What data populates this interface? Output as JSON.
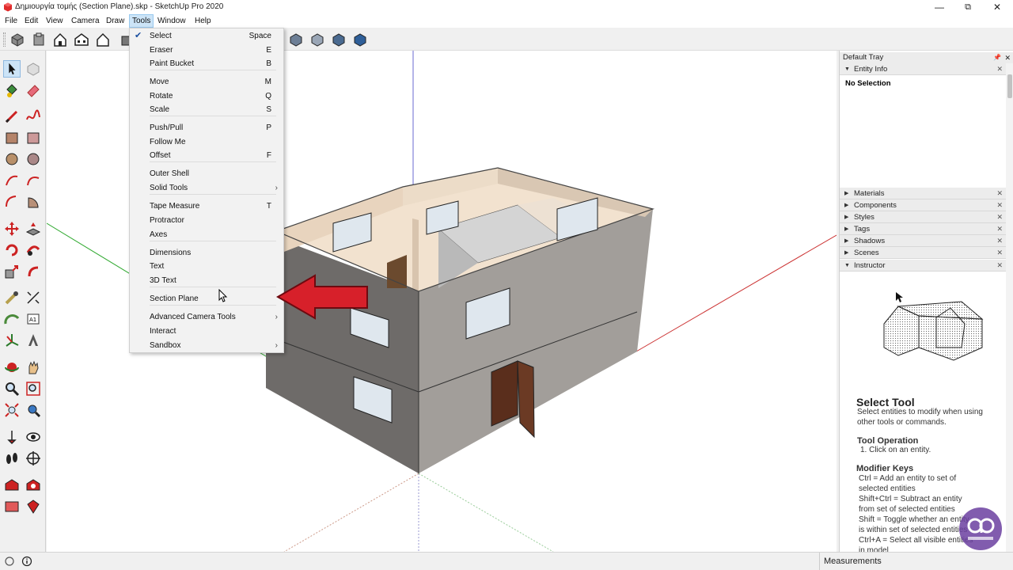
{
  "window": {
    "title": "Δημιουργία τομής (Section Plane).skp - SketchUp Pro 2020",
    "minimize": "—",
    "maximize": "⧉",
    "close": "✕"
  },
  "menubar": {
    "items": [
      "File",
      "Edit",
      "View",
      "Camera",
      "Draw",
      "Tools",
      "Window",
      "Help"
    ],
    "active": "Tools"
  },
  "tools_menu": {
    "items": [
      {
        "label": "Select",
        "shortcut": "Space",
        "checked": true
      },
      {
        "label": "Eraser",
        "shortcut": "E"
      },
      {
        "label": "Paint Bucket",
        "shortcut": "B"
      },
      {
        "label": "Move",
        "shortcut": "M"
      },
      {
        "label": "Rotate",
        "shortcut": "Q"
      },
      {
        "label": "Scale",
        "shortcut": "S"
      },
      {
        "label": "Push/Pull",
        "shortcut": "P"
      },
      {
        "label": "Follow Me",
        "shortcut": ""
      },
      {
        "label": "Offset",
        "shortcut": "F"
      },
      {
        "label": "Outer Shell",
        "shortcut": ""
      },
      {
        "label": "Solid Tools",
        "shortcut": "",
        "submenu": true
      },
      {
        "label": "Tape Measure",
        "shortcut": "T"
      },
      {
        "label": "Protractor",
        "shortcut": ""
      },
      {
        "label": "Axes",
        "shortcut": ""
      },
      {
        "label": "Dimensions",
        "shortcut": ""
      },
      {
        "label": "Text",
        "shortcut": ""
      },
      {
        "label": "3D Text",
        "shortcut": ""
      },
      {
        "label": "Section Plane",
        "shortcut": ""
      },
      {
        "label": "Advanced Camera Tools",
        "shortcut": "",
        "submenu": true
      },
      {
        "label": "Interact",
        "shortcut": ""
      },
      {
        "label": "Sandbox",
        "shortcut": "",
        "submenu": true
      }
    ]
  },
  "tray": {
    "title": "Default Tray",
    "entity_info": {
      "label": "Entity Info",
      "value": "No Selection"
    },
    "panels": [
      "Materials",
      "Components",
      "Styles",
      "Tags",
      "Shadows",
      "Scenes",
      "Instructor"
    ]
  },
  "instructor": {
    "title": "Select Tool",
    "description": "Select entities to modify when using other tools or commands.",
    "operation_heading": "Tool Operation",
    "operation_step": "1. Click on an entity.",
    "modifier_heading": "Modifier Keys",
    "modifiers": [
      "Ctrl = Add an entity to set of selected entities",
      "Shift+Ctrl = Subtract an entity from set of selected entities",
      "Shift = Toggle whether an entity is within set of selected entities",
      "Ctrl+A = Select all visible entities in model"
    ]
  },
  "statusbar": {
    "measurements_label": "Measurements"
  },
  "colors": {
    "accent": "#1a4fa0",
    "arrow": "#d7202a",
    "wall": "#a39f9b",
    "interior": "#f2e2cf"
  }
}
